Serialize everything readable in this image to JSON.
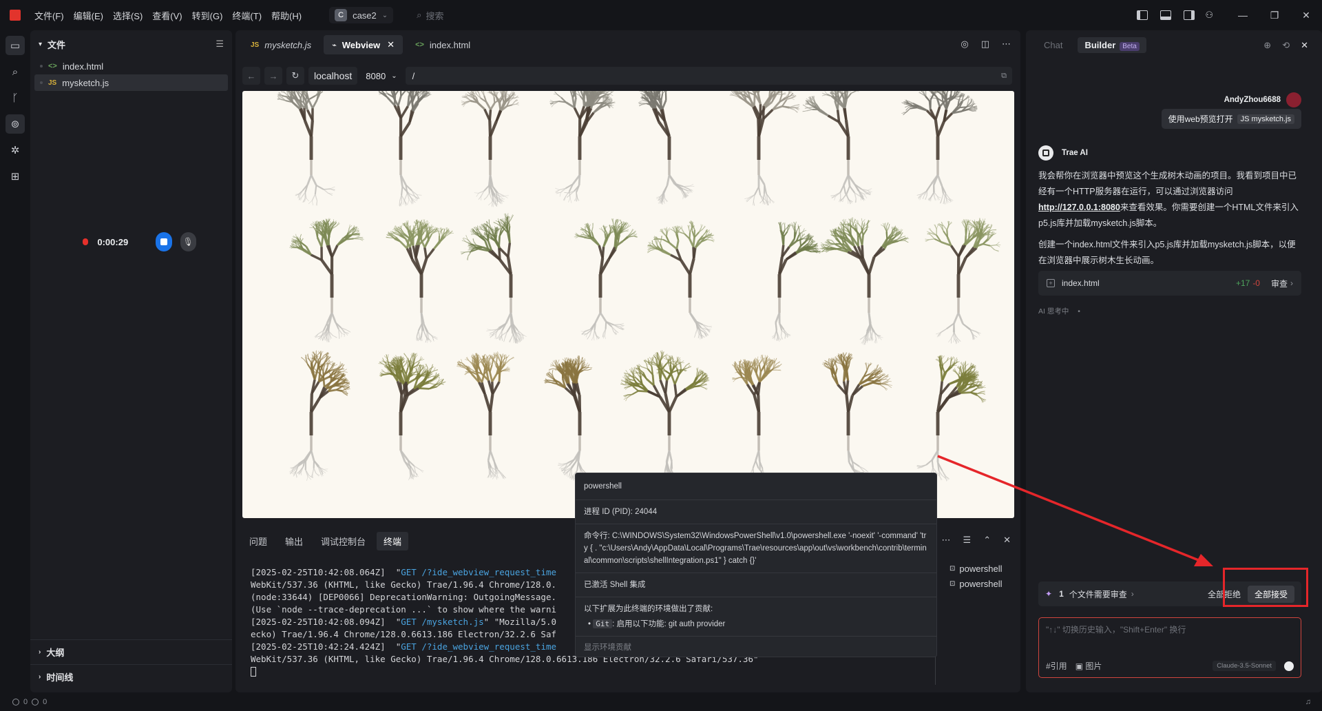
{
  "titlebar": {
    "menus": [
      "文件(F)",
      "编辑(E)",
      "选择(S)",
      "查看(V)",
      "转到(G)",
      "终端(T)",
      "帮助(H)"
    ],
    "project_badge": "C",
    "project": "case2",
    "search_placeholder": "搜索",
    "brand_color": "#e2342c"
  },
  "explorer": {
    "title": "文件",
    "files": [
      {
        "icon": "<>",
        "name": "index.html"
      },
      {
        "icon": "JS",
        "name": "mysketch.js"
      }
    ],
    "outline": "大纲",
    "timeline": "时间线"
  },
  "recorder": {
    "time": "0:00:29",
    "stop_color": "#1a73e8"
  },
  "editor": {
    "tabs": [
      {
        "icon": "JS",
        "label": "mysketch.js"
      },
      {
        "icon": "webview-icon",
        "label": "Webview"
      },
      {
        "icon": "<>",
        "label": "index.html"
      }
    ],
    "url_host": "localhost",
    "url_port": "8080",
    "url_path": "/"
  },
  "panel": {
    "tabs": [
      "问题",
      "输出",
      "调试控制台",
      "终端"
    ],
    "terminal_lines": [
      {
        "pre": "[2025-02-25T10:42:08.064Z]  \"",
        "url": "GET /?ide_webview_request_time",
        "post": ""
      },
      {
        "pre": "WebKit/537.36 (KHTML, like Gecko) Trae/1.96.4 Chrome/128.0.",
        "url": "",
        "post": ""
      },
      {
        "pre": "(node:33644) [DEP0066] DeprecationWarning: OutgoingMessage.",
        "url": "",
        "post": ""
      },
      {
        "pre": "(Use `node --trace-deprecation ...` to show where the warni",
        "url": "",
        "post": ""
      },
      {
        "pre": "[2025-02-25T10:42:08.094Z]  \"",
        "url": "GET /mysketch.js",
        "post": "\" \"Mozilla/5.0"
      },
      {
        "pre": "ecko) Trae/1.96.4 Chrome/128.0.6613.186 Electron/32.2.6 Saf",
        "url": "",
        "post": ""
      },
      {
        "pre": "[2025-02-25T10:42:24.424Z]  \"",
        "url": "GET /?ide_webview_request_time",
        "post": ""
      },
      {
        "pre": "WebKit/537.36 (KHTML, like Gecko) Trae/1.96.4 Chrome/128.0.6613.186 Electron/32.2.6 Safari/537.36\"",
        "url": "",
        "post": ""
      }
    ],
    "terminals": [
      "powershell",
      "powershell"
    ]
  },
  "popup": {
    "title": "powershell",
    "pid": "进程 ID (PID): 24044",
    "command": "命令行: C:\\WINDOWS\\System32\\WindowsPowerShell\\v1.0\\powershell.exe '-noexit' '-command' 'try { . \"c:\\Users\\Andy\\AppData\\Local\\Programs\\Trae\\resources\\app\\out\\vs\\workbench\\contrib\\terminal\\common\\scripts\\shellIntegration.ps1\" } catch {}'",
    "shell": "已激活 Shell 集成",
    "ext_title": "以下扩展为此终端的环境做出了贡献:",
    "ext_chip": "Git",
    "ext_desc": ": 启用以下功能: git auth provider",
    "footer": "显示环境贡献"
  },
  "ai": {
    "tabs": [
      "Chat",
      "Builder"
    ],
    "beta": "Beta",
    "user": "AndyZhou6688",
    "user_msg": "使用web预览打开",
    "user_chip": "JS mysketch.js",
    "bot_name": "Trae AI",
    "para1_a": "我会帮你在浏览器中预览这个生成树木动画的项目。我看到项目中已经有一个HTTP服务器在运行，可以通过浏览器访问",
    "para1_link": "http://127.0.0.1:8080",
    "para1_b": "来查看效果。你需要创建一个HTML文件来引入p5.js库并加载mysketch.js脚本。",
    "para2": "创建一个index.html文件来引入p5.js库并加载mysketch.js脚本，以便在浏览器中展示树木生长动画。",
    "file_card": "index.html",
    "added": "+17",
    "removed": "-0",
    "review": "审查",
    "thinking": "AI 思考中",
    "thinking_dots": "•",
    "review_count": "1",
    "review_text": "个文件需要审查",
    "reject_all": "全部拒绝",
    "accept_all": "全部接受",
    "input_placeholder": "\"↑↓\" 切换历史输入，\"Shift+Enter\" 换行",
    "cite": "#引用",
    "image": "图片",
    "model": "Claude-3.5-Sonnet"
  },
  "status": {
    "errors": "0",
    "warnings": "0"
  }
}
